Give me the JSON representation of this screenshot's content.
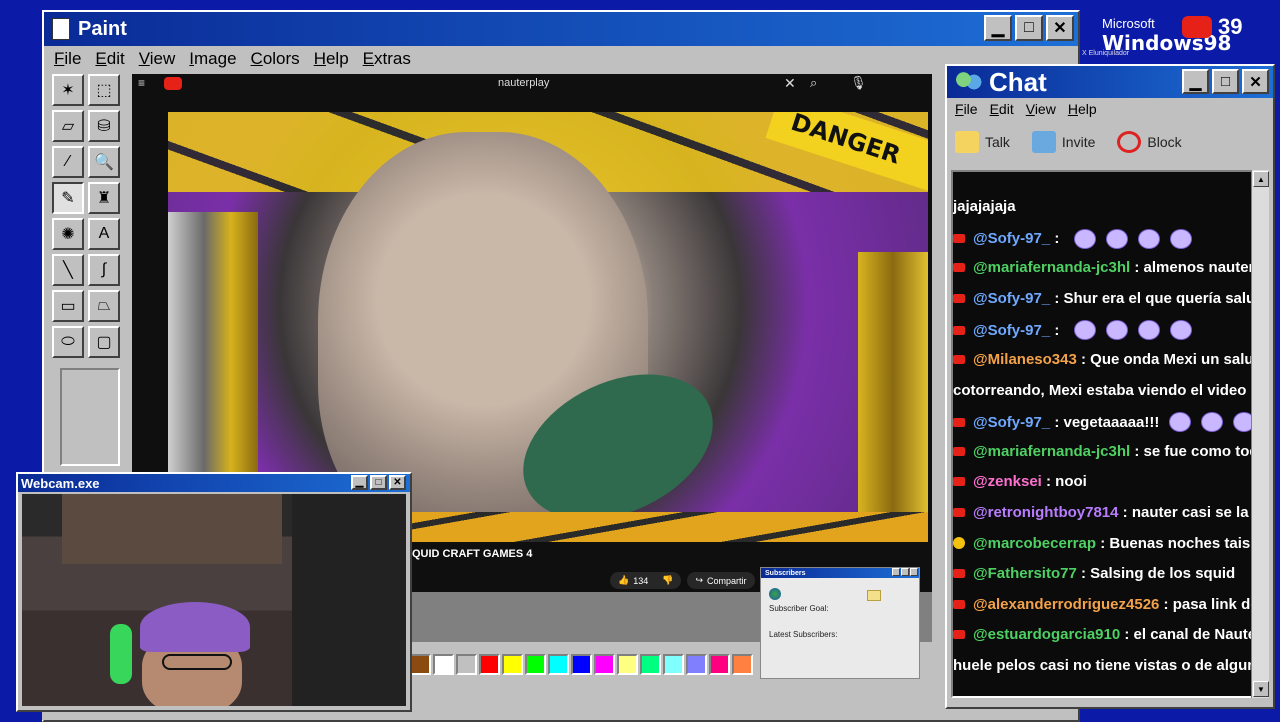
{
  "desktop": {
    "brand_line1": "Microsoft",
    "brand_line2": "Windows98",
    "live_count": "39",
    "brand_sub": "X Eluniquilador"
  },
  "paint": {
    "title": "Paint",
    "menu": [
      "File",
      "Edit",
      "View",
      "Image",
      "Colors",
      "Help",
      "Extras"
    ],
    "tools": [
      {
        "name": "free-select-tool",
        "glyph": "✶"
      },
      {
        "name": "rect-select-tool",
        "glyph": "⬚"
      },
      {
        "name": "eraser-tool",
        "glyph": "▱"
      },
      {
        "name": "fill-tool",
        "glyph": "⛁"
      },
      {
        "name": "color-picker-tool",
        "glyph": "⁄"
      },
      {
        "name": "magnifier-tool",
        "glyph": "🔍"
      },
      {
        "name": "pencil-tool",
        "glyph": "✎"
      },
      {
        "name": "brush-tool",
        "glyph": "♜"
      },
      {
        "name": "airbrush-tool",
        "glyph": "✺"
      },
      {
        "name": "text-tool",
        "glyph": "A"
      },
      {
        "name": "line-tool",
        "glyph": "╲"
      },
      {
        "name": "curve-tool",
        "glyph": "∫"
      },
      {
        "name": "rectangle-tool",
        "glyph": "▭"
      },
      {
        "name": "polygon-tool",
        "glyph": "⏢"
      },
      {
        "name": "ellipse-tool",
        "glyph": "⬭"
      },
      {
        "name": "rounded-rect-tool",
        "glyph": "▢"
      }
    ],
    "palette": [
      "#8a4a10",
      "#ffffff",
      "#c0c0c0",
      "#ff0000",
      "#ffff00",
      "#00ff00",
      "#00ffff",
      "#0000ff",
      "#ff00ff",
      "#ffff80",
      "#00ff80",
      "#80ffff",
      "#8080ff",
      "#ff0080",
      "#ff8040"
    ]
  },
  "browser": {
    "search_text": "nauterplay",
    "video_title": "QUID CRAFT GAMES 4",
    "danger_label": "DANGER",
    "like_count": "134",
    "share_label": "Compartir"
  },
  "subscribers": {
    "title": "Subscribers",
    "goal_label": "Subscriber Goal:",
    "latest_label": "Latest Subscribers:"
  },
  "webcam": {
    "title": "Webcam.exe"
  },
  "chat": {
    "title": "Chat",
    "menu": [
      "File",
      "Edit",
      "View",
      "Help"
    ],
    "toolbar": [
      {
        "name": "talk-button",
        "label": "Talk",
        "icon": "talk-icon"
      },
      {
        "name": "invite-button",
        "label": "Invite",
        "icon": "invite-icon"
      },
      {
        "name": "block-button",
        "label": "Block",
        "icon": "block-icon"
      }
    ],
    "messages": [
      {
        "icon": "none",
        "user": "",
        "text": "jajajajaja",
        "color": "",
        "emotes": 0
      },
      {
        "icon": "yt",
        "user": "@Sofy-97_",
        "text": " : ",
        "color": "user-blue",
        "emotes": 4
      },
      {
        "icon": "yt",
        "user": "@mariafernanda-jc3hl",
        "text": " : almenos nauter si",
        "color": "user-green",
        "emotes": 0
      },
      {
        "icon": "yt",
        "user": "@Sofy-97_",
        "text": " : Shur era el que quería saludo",
        "color": "user-blue",
        "emotes": 0
      },
      {
        "icon": "yt",
        "user": "@Sofy-97_",
        "text": " : ",
        "color": "user-blue",
        "emotes": 4
      },
      {
        "icon": "yt",
        "user": "@Milaneso343",
        "text": " : Que onda Mexi un saludo",
        "color": "user-orange",
        "emotes": 0
      },
      {
        "icon": "none",
        "user": "",
        "text": "cotorreando, Mexi estaba viendo el video con",
        "color": "",
        "emotes": 0
      },
      {
        "icon": "yt",
        "user": "@Sofy-97_",
        "text": " : vegetaaaaa!!!",
        "color": "user-blue",
        "emotes": 4
      },
      {
        "icon": "yt",
        "user": "@mariafernanda-jc3hl",
        "text": " : se fue como todo",
        "color": "user-green",
        "emotes": 0
      },
      {
        "icon": "yt",
        "user": "@zenksei",
        "text": " : nooi",
        "color": "user-pink",
        "emotes": 0
      },
      {
        "icon": "yt",
        "user": "@retronightboy7814",
        "text": " : nauter casi se la chu",
        "color": "user-purple",
        "emotes": 0
      },
      {
        "icon": "star",
        "user": "@marcobecerrap",
        "text": " : Buenas noches tais!",
        "color": "user-green",
        "emotes": 0
      },
      {
        "icon": "yt",
        "user": "@Fathersito77",
        "text": " : Salsing de los squid",
        "color": "user-green",
        "emotes": 0
      },
      {
        "icon": "yt",
        "user": "@alexanderrodriguez4526",
        "text": " : pasa link de e",
        "color": "user-orange",
        "emotes": 0
      },
      {
        "icon": "yt",
        "user": "@estuardogarcia910",
        "text": " : el canal de Nauter c",
        "color": "user-green",
        "emotes": 0
      },
      {
        "icon": "none",
        "user": "",
        "text": "huele pelos casi no tiene vistas o de algun otr",
        "color": "",
        "emotes": 0
      }
    ]
  }
}
